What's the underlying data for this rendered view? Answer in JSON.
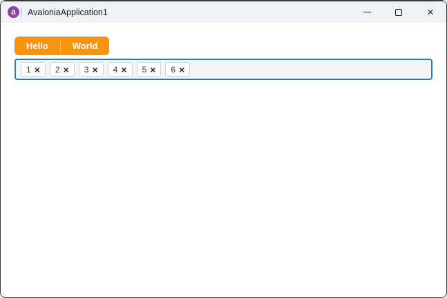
{
  "window": {
    "title": "AvaloniaApplication1",
    "icons": {
      "close": "×"
    }
  },
  "app_icon": {
    "letter": "a"
  },
  "toolbar": {
    "hello_label": "Hello",
    "world_label": "World",
    "accent_color": "#f6940d"
  },
  "chip_input": {
    "border_color": "#2b7dc0",
    "remove_glyph": "×",
    "chips": [
      {
        "label": "1"
      },
      {
        "label": "2"
      },
      {
        "label": "3"
      },
      {
        "label": "4"
      },
      {
        "label": "5"
      },
      {
        "label": "6"
      }
    ]
  }
}
